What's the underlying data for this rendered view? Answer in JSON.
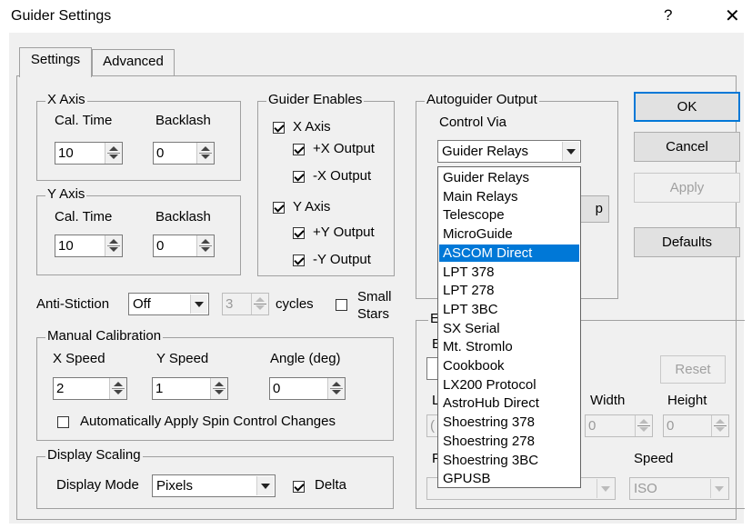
{
  "window": {
    "title": "Guider Settings",
    "help_glyph": "?",
    "close_glyph": "✕"
  },
  "tabs": [
    "Settings",
    "Advanced"
  ],
  "x_axis": {
    "group": "X Axis",
    "cal_time_label": "Cal. Time",
    "cal_time": "10",
    "backlash_label": "Backlash",
    "backlash": "0"
  },
  "y_axis": {
    "group": "Y Axis",
    "cal_time_label": "Cal. Time",
    "cal_time": "10",
    "backlash_label": "Backlash",
    "backlash": "0"
  },
  "guider_enables": {
    "group": "Guider Enables",
    "x_axis": "X Axis",
    "plus_x": "+X Output",
    "minus_x": "-X Output",
    "y_axis": "Y Axis",
    "plus_y": "+Y Output",
    "minus_y": "-Y Output",
    "checked": [
      true,
      true,
      true,
      true,
      true,
      true
    ]
  },
  "autoguider_output": {
    "group": "Autoguider Output",
    "control_via_label": "Control Via",
    "control_via": "Guider Relays",
    "hidden_button_fragment": "p",
    "options": [
      "Guider Relays",
      "Main Relays",
      "Telescope",
      "MicroGuide",
      "ASCOM Direct",
      "LPT 378",
      "LPT 278",
      "LPT 3BC",
      "SX Serial",
      "Mt. Stromlo",
      "Cookbook",
      "LX200 Protocol",
      "AstroHub Direct",
      "Shoestring 378",
      "Shoestring 278",
      "Shoestring 3BC",
      "GPUSB"
    ],
    "highlighted": "ASCOM Direct"
  },
  "buttons": {
    "ok": "OK",
    "cancel": "Cancel",
    "apply": "Apply",
    "defaults": "Defaults"
  },
  "anti_stiction": {
    "label": "Anti-Stiction",
    "mode": "Off",
    "cycles_value": "3",
    "cycles_label": "cycles",
    "small_stars_line1": "Small",
    "small_stars_line2": "Stars",
    "small_stars_checked": false
  },
  "manual_calibration": {
    "group": "Manual Calibration",
    "x_speed_label": "X Speed",
    "x_speed": "2",
    "y_speed_label": "Y Speed",
    "y_speed": "1",
    "angle_label": "Angle (deg)",
    "angle": "0",
    "auto_apply_label": "Automatically Apply Spin Control Changes",
    "auto_apply_checked": false
  },
  "display_scaling": {
    "group": "Display Scaling",
    "mode_label": "Display Mode",
    "mode": "Pixels",
    "delta_label": "Delta",
    "delta_checked": true
  },
  "partial_group": {
    "group_fragment": "E",
    "label_fragment_1": "E",
    "reset": "Reset",
    "label_fragment_2": "L",
    "width_label": "Width",
    "width": "0",
    "height_label": "Height",
    "height": "0",
    "spin_fragment": "(",
    "label_fragment_3": "F",
    "speed_label": "Speed",
    "speed": "ISO"
  }
}
